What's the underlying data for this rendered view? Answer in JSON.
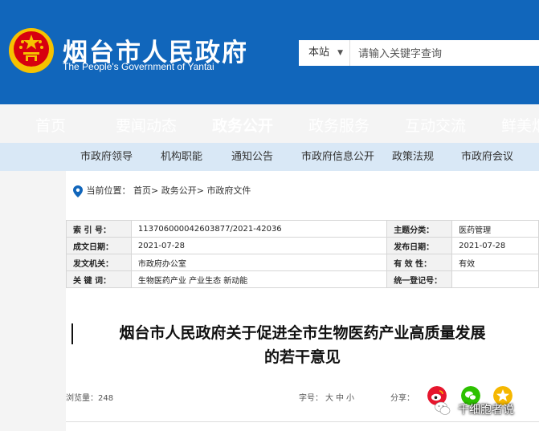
{
  "header": {
    "site_title": "烟台市人民政府",
    "site_subtitle": "The People's Government of Yantai",
    "emblem_icon": "national-emblem-icon"
  },
  "search": {
    "scope": "本站",
    "placeholder": "请输入关键字查询"
  },
  "main_nav": [
    "首页",
    "要闻动态",
    "政务公开",
    "政务服务",
    "互动交流",
    "鲜美烟"
  ],
  "main_nav_active": "政务公开",
  "sub_nav": [
    "市政府领导",
    "机构职能",
    "通知公告",
    "市政府信息公开",
    "政策法规",
    "市政府会议"
  ],
  "breadcrumb": {
    "label": "当前位置：",
    "items": [
      "首页>",
      "政务公开>",
      "市政府文件"
    ]
  },
  "meta": {
    "rows": [
      {
        "l1": "索 引 号：",
        "v1": "113706000042603877/2021-42036",
        "l2": "主题分类：",
        "v2": "医药管理"
      },
      {
        "l1": "成文日期：",
        "v1": "2021-07-28",
        "l2": "发布日期：",
        "v2": "2021-07-28"
      },
      {
        "l1": "发文机关：",
        "v1": "市政府办公室",
        "l2": "有 效 性：",
        "v2": "有效"
      },
      {
        "l1": "关 键 词：",
        "v1": "生物医药产业 产业生态 新动能",
        "l2": "统一登记号：",
        "v2": ""
      }
    ]
  },
  "document": {
    "title_line1": "烟台市人民政府关于促进全市生物医药产业高质量发展",
    "title_line2": "的若干意见"
  },
  "toolbar": {
    "views_label": "浏览量：",
    "views_count": "248",
    "fontsize_label": "字号：",
    "font_large": "大",
    "font_medium": "中",
    "font_small": "小",
    "share_label": "分享："
  },
  "share_icons": [
    "weibo-icon",
    "wechat-icon",
    "qzone-icon"
  ],
  "watermark": {
    "text": "千细胞者说",
    "icon": "wechat-logo-icon"
  },
  "colors": {
    "brand_blue": "#1166bb",
    "subnav_bg": "#d9e8f6",
    "emblem_red": "#d7000f",
    "gold": "#f6c200"
  }
}
